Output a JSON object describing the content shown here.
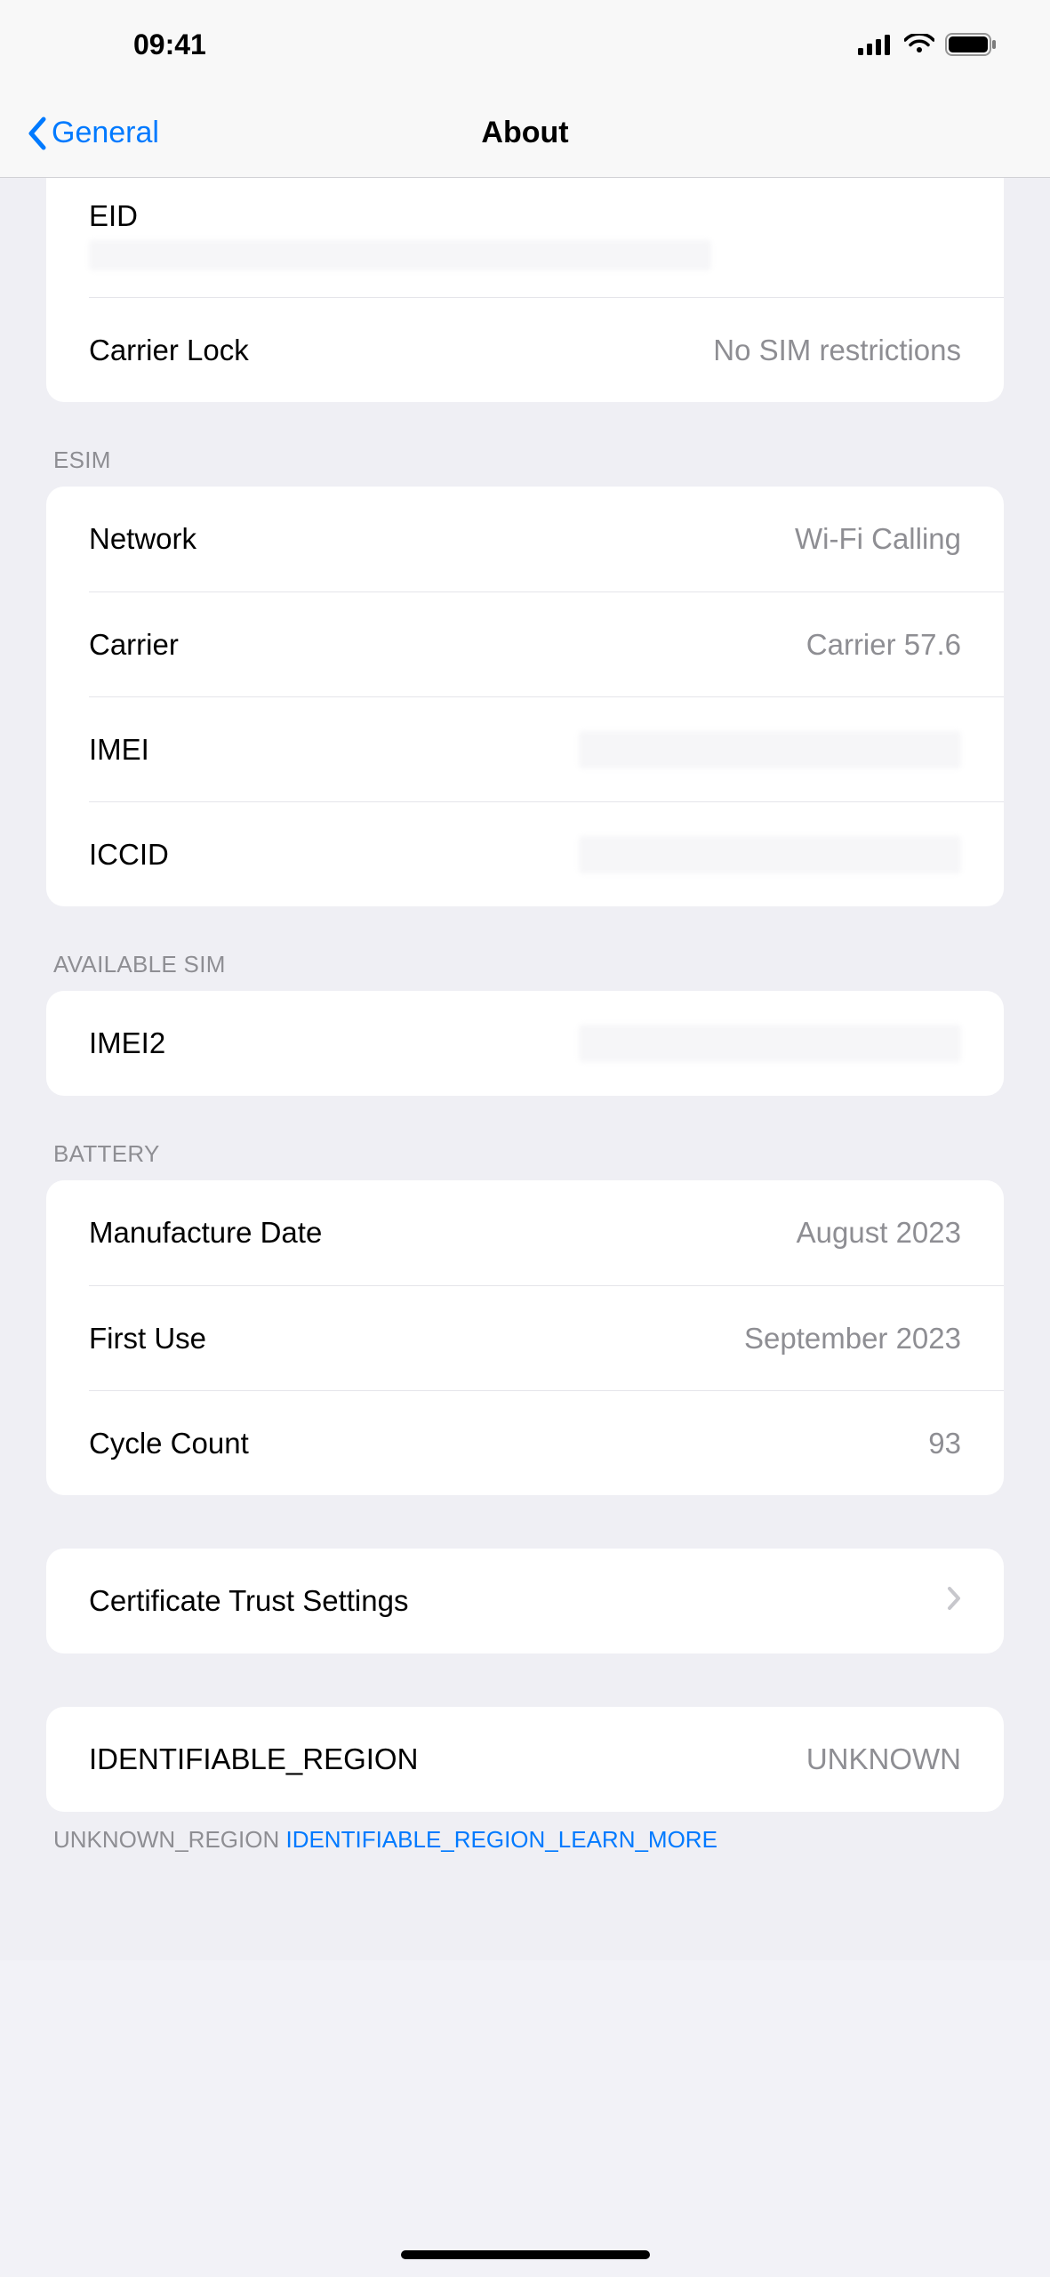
{
  "status": {
    "time": "09:41"
  },
  "nav": {
    "back_label": "General",
    "title": "About"
  },
  "about_group1": {
    "eid_label": "EID",
    "carrier_lock_label": "Carrier Lock",
    "carrier_lock_value": "No SIM restrictions"
  },
  "esim_header": "ESIM",
  "esim": {
    "network_label": "Network",
    "network_value": "Wi-Fi Calling",
    "carrier_label": "Carrier",
    "carrier_value": "Carrier 57.6",
    "imei_label": "IMEI",
    "iccid_label": "ICCID"
  },
  "avail_header": "AVAILABLE SIM",
  "avail": {
    "imei2_label": "IMEI2"
  },
  "battery_header": "BATTERY",
  "battery": {
    "manufacture_label": "Manufacture Date",
    "manufacture_value": "August 2023",
    "first_use_label": "First Use",
    "first_use_value": "September 2023",
    "cycle_label": "Cycle Count",
    "cycle_value": "93"
  },
  "cert": {
    "label": "Certificate Trust Settings"
  },
  "region": {
    "label": "IDENTIFIABLE_REGION",
    "value": "UNKNOWN"
  },
  "footer": {
    "prefix": "UNKNOWN_REGION ",
    "link": "IDENTIFIABLE_REGION_LEARN_MORE"
  }
}
